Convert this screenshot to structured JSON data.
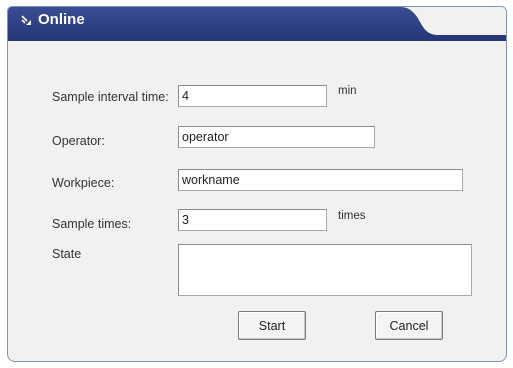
{
  "window": {
    "title": "Online",
    "icon": "double-chevron-icon",
    "title_color": "#2c3e7f"
  },
  "form": {
    "sample_interval": {
      "label": "Sample interval time:",
      "value": "4",
      "unit": "min"
    },
    "operator": {
      "label": "Operator:",
      "value": "operator"
    },
    "workpiece": {
      "label": "Workpiece:",
      "value": "workname"
    },
    "sample_times": {
      "label": "Sample times:",
      "value": "3",
      "unit": "times"
    },
    "state": {
      "label": "State",
      "value": ""
    }
  },
  "buttons": {
    "start_label": "Start",
    "cancel_label": "Cancel"
  }
}
